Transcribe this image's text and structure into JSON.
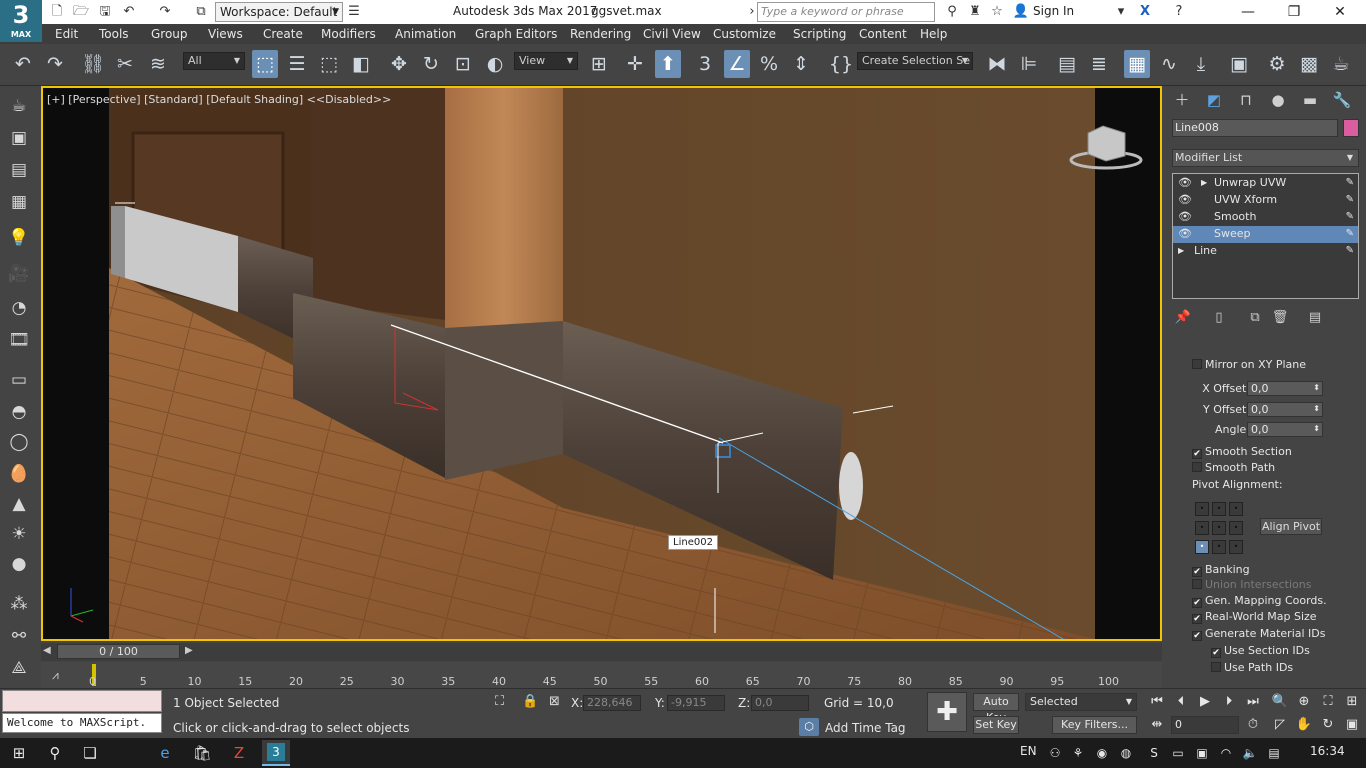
{
  "app": {
    "logo_big": "3",
    "logo_small": "MAX",
    "workspace": "Workspace: Default",
    "title": "Autodesk 3ds Max 2017",
    "file": "ggsvet.max",
    "search_placeholder": "Type a keyword or phrase",
    "sign_in": "Sign In"
  },
  "menu": [
    "Edit",
    "Tools",
    "Group",
    "Views",
    "Create",
    "Modifiers",
    "Animation",
    "Graph Editors",
    "Rendering",
    "Civil View",
    "Customize",
    "Scripting",
    "Content",
    "Help"
  ],
  "toolbar": {
    "filter": "All",
    "ref_coord": "View",
    "selection_set": "Create Selection Se"
  },
  "viewport": {
    "label": "[+] [Perspective] [Standard] [Default Shading]  <<Disabled>>",
    "tooltip": "Line002"
  },
  "command_panel": {
    "object_name": "Line008",
    "object_color": "#d95d9f",
    "modifier_list": "Modifier List",
    "stack": [
      {
        "label": "Unwrap UVW",
        "expandable": true,
        "selected": false
      },
      {
        "label": "UVW Xform",
        "expandable": false,
        "selected": false
      },
      {
        "label": "Smooth",
        "expandable": false,
        "selected": false
      },
      {
        "label": "Sweep",
        "expandable": false,
        "selected": true
      },
      {
        "label": "Line",
        "expandable": true,
        "selected": false
      }
    ],
    "params": {
      "mirror_xy": "Mirror on XY Plane",
      "x_offset_label": "X Offset:",
      "x_offset": "0,0",
      "y_offset_label": "Y Offset:",
      "y_offset": "0,0",
      "angle_label": "Angle:",
      "angle": "0,0",
      "smooth_section": "Smooth Section",
      "smooth_path": "Smooth Path",
      "pivot_alignment": "Pivot Alignment:",
      "align_pivot": "Align Pivot",
      "banking": "Banking",
      "union_intersections": "Union Intersections",
      "gen_mapping": "Gen. Mapping Coords.",
      "real_world": "Real-World Map Size",
      "gen_material": "Generate Material IDs",
      "use_section": "Use Section IDs",
      "use_path": "Use Path IDs"
    }
  },
  "timeline": {
    "frame": "0 / 100",
    "ticks": [
      "0",
      "5",
      "10",
      "15",
      "20",
      "25",
      "30",
      "35",
      "40",
      "45",
      "50",
      "55",
      "60",
      "65",
      "70",
      "75",
      "80",
      "85",
      "90",
      "95",
      "100"
    ]
  },
  "status": {
    "maxscript": "Welcome to MAXScript.",
    "selected": "1 Object Selected",
    "prompt": "Click or click-and-drag to select objects",
    "x_label": "X:",
    "x": "228,646",
    "y_label": "Y:",
    "y": "-9,915",
    "z_label": "Z:",
    "z": "0,0",
    "grid": "Grid = 10,0",
    "add_time_tag": "Add Time Tag",
    "auto_key": "Auto Key",
    "set_key": "Set Key",
    "key_mode": "Selected",
    "key_filters": "Key Filters...",
    "frame_field": "0"
  },
  "taskbar": {
    "lang": "EN",
    "time": "16:34"
  }
}
